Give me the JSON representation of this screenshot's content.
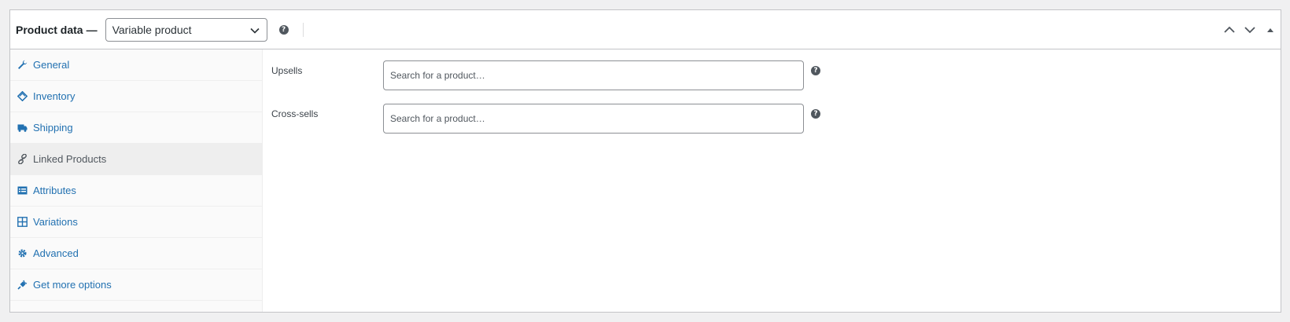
{
  "header": {
    "title": "Product data",
    "dash": "—",
    "product_type": "Variable product",
    "help": "?"
  },
  "tabs": [
    {
      "label": "General",
      "icon": "wrench-icon"
    },
    {
      "label": "Inventory",
      "icon": "tag-icon"
    },
    {
      "label": "Shipping",
      "icon": "truck-icon"
    },
    {
      "label": "Linked Products",
      "icon": "link-icon",
      "active": true
    },
    {
      "label": "Attributes",
      "icon": "list-icon"
    },
    {
      "label": "Variations",
      "icon": "grid-icon"
    },
    {
      "label": "Advanced",
      "icon": "gear-icon"
    },
    {
      "label": "Get more options",
      "icon": "plugin-icon"
    }
  ],
  "fields": {
    "upsells": {
      "label": "Upsells",
      "placeholder": "Search for a product…"
    },
    "crosssells": {
      "label": "Cross-sells",
      "placeholder": "Search for a product…"
    }
  },
  "colors": {
    "link": "#2271b1",
    "border": "#c3c4c7",
    "active_tab_bg": "#eeeeee"
  }
}
